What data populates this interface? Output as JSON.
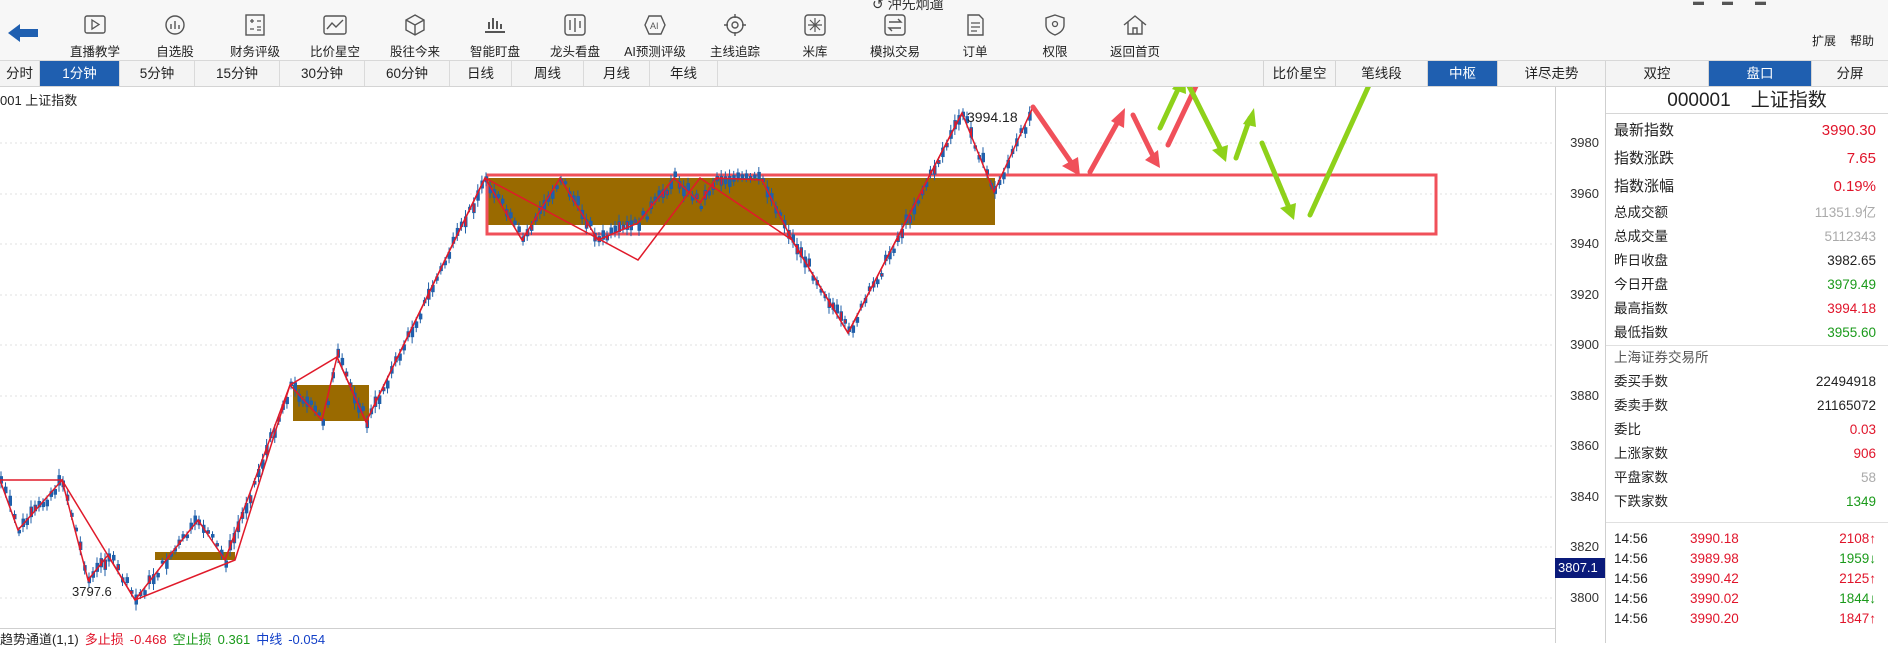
{
  "window": {
    "title_fragment": "↺ 沖先炯遛",
    "expand": "扩展",
    "help": "帮助"
  },
  "toolbar": [
    {
      "label": "直播教学",
      "icon": "play-icon"
    },
    {
      "label": "自选股",
      "icon": "chart-gauge-icon"
    },
    {
      "label": "财务评级",
      "icon": "calculator-icon"
    },
    {
      "label": "比价星空",
      "icon": "line-chart-icon"
    },
    {
      "label": "股往今来",
      "icon": "cube-icon"
    },
    {
      "label": "智能盯盘",
      "icon": "monitor-chart-icon"
    },
    {
      "label": "龙头看盘",
      "icon": "dragon-icon"
    },
    {
      "label": "AI预测评级",
      "icon": "ai-icon"
    },
    {
      "label": "主线追踪",
      "icon": "target-icon"
    },
    {
      "label": "米库",
      "icon": "rice-icon"
    },
    {
      "label": "模拟交易",
      "icon": "exchange-icon"
    },
    {
      "label": "订单",
      "icon": "document-icon"
    },
    {
      "label": "权限",
      "icon": "shield-icon"
    },
    {
      "label": "返回首页",
      "icon": "home-icon"
    }
  ],
  "period_tabs": [
    "分时",
    "1分钟",
    "5分钟",
    "15分钟",
    "30分钟",
    "60分钟",
    "日线",
    "周线",
    "月线",
    "年线"
  ],
  "active_period": "1分钟",
  "chart_tabs": [
    "比价星空",
    "笔线段",
    "中枢",
    "详尽走势"
  ],
  "active_chart_tab": "中枢",
  "panel_tabs": [
    "双控",
    "盘口",
    "分屏"
  ],
  "active_panel_tab": "盘口",
  "stock_label": "001 上证指数",
  "y_ticks": [
    "3980",
    "3960",
    "3940",
    "3920",
    "3900",
    "3880",
    "3860",
    "3840",
    "3820",
    "3800"
  ],
  "last_price_tag": "3807.1",
  "high_label": "3994.18",
  "low_label": "3797.6",
  "indicator": {
    "name": "趋势通道(1,1)",
    "long_label": "多止损",
    "long_value": "-0.468",
    "short_label": "空止损",
    "short_value": "0.361",
    "mid_label": "中线",
    "mid_value": "-0.054"
  },
  "quote": {
    "code": "000001",
    "name": "上证指数",
    "main_rows": [
      {
        "label": "最新指数",
        "value": "3990.30",
        "color": "red"
      },
      {
        "label": "指数涨跌",
        "value": "7.65",
        "color": "red"
      },
      {
        "label": "指数涨幅",
        "value": "0.19%",
        "color": "red"
      }
    ],
    "stat_rows": [
      {
        "label": "总成交额",
        "value": "11351.9亿",
        "color": "gray"
      },
      {
        "label": "总成交量",
        "value": "5112343",
        "color": "gray"
      },
      {
        "label": "昨日收盘",
        "value": "3982.65",
        "color": "black"
      },
      {
        "label": "今日开盘",
        "value": "3979.49",
        "color": "green"
      },
      {
        "label": "最高指数",
        "value": "3994.18",
        "color": "red"
      },
      {
        "label": "最低指数",
        "value": "3955.60",
        "color": "green"
      }
    ],
    "exchange": "上海证券交易所",
    "exchange_rows": [
      {
        "label": "委买手数",
        "value": "22494918",
        "color": "black"
      },
      {
        "label": "委卖手数",
        "value": "21165072",
        "color": "black"
      },
      {
        "label": "委比",
        "value": "0.03",
        "color": "red"
      },
      {
        "label": "上涨家数",
        "value": "906",
        "color": "red"
      },
      {
        "label": "平盘家数",
        "value": "58",
        "color": "gray"
      },
      {
        "label": "下跌家数",
        "value": "1349",
        "color": "green"
      }
    ],
    "ticks": [
      {
        "time": "14:56",
        "price": "3990.18",
        "vol": "2108↑",
        "color": "red"
      },
      {
        "time": "14:56",
        "price": "3989.98",
        "vol": "1959↓",
        "color": "green"
      },
      {
        "time": "14:56",
        "price": "3990.42",
        "vol": "2125↑",
        "color": "red"
      },
      {
        "time": "14:56",
        "price": "3990.02",
        "vol": "1844↓",
        "color": "green"
      },
      {
        "time": "14:56",
        "price": "3990.20",
        "vol": "1847↑",
        "color": "red"
      }
    ]
  },
  "colors": {
    "accent": "#1f5fb0",
    "up": "#e0142a",
    "down": "#1a9a1a",
    "zone_fill": "#9a6a00",
    "arrow_red": "#f0505a",
    "arrow_green": "#8ed11a"
  }
}
